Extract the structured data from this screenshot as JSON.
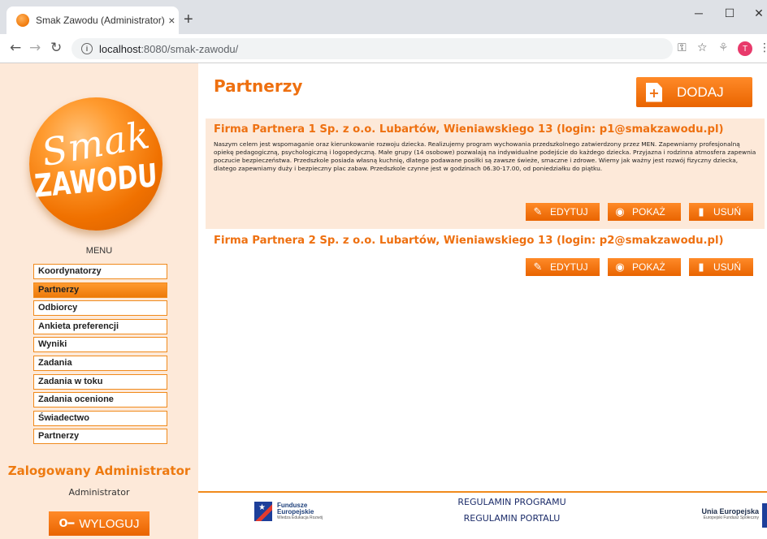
{
  "browser": {
    "tab_title": "Smak Zawodu (Administrator)",
    "tab_close": "×",
    "new_tab": "+",
    "url_host": "localhost",
    "url_path": ":8080/smak-zawodu/",
    "profile_initial": "T"
  },
  "sidebar": {
    "logo_top": "Smak",
    "logo_bottom": "ZAWODU",
    "menu_title": "MENU",
    "menu_items": [
      {
        "label": "Koordynatorzy",
        "active": false
      },
      {
        "label": "Partnerzy",
        "active": true
      },
      {
        "label": "Odbiorcy",
        "active": false
      },
      {
        "label": "Ankieta preferencji",
        "active": false
      },
      {
        "label": "Wyniki",
        "active": false
      },
      {
        "label": "Zadania",
        "active": false
      },
      {
        "label": "Zadania w toku",
        "active": false
      },
      {
        "label": "Zadania ocenione",
        "active": false
      },
      {
        "label": "Świadectwo",
        "active": false
      },
      {
        "label": "Partnerzy",
        "active": false
      }
    ],
    "logged_title": "Zalogowany Administrator",
    "logged_name": "Administrator",
    "logout_label": "WYLOGUJ"
  },
  "main": {
    "title": "Partnerzy",
    "add_label": "DODAJ",
    "edit_label": "EDYTUJ",
    "show_label": "POKAŻ",
    "delete_label": "USUŃ",
    "partners": [
      {
        "name": "Firma Partnera 1 Sp. z o.o. Lubartów, Wieniawskiego 13 (login: p1@smakzawodu.pl)",
        "description": "Naszym celem jest wspomaganie oraz kierunkowanie rozwoju dziecka. Realizujemy program wychowania przedszkolnego zatwierdzony przez MEN. Zapewniamy profesjonalną opiekę pedagogiczną, psychologiczną i logopedyczną. Małe grupy (14 osobowe) pozwalają na indywidualne podejście do każdego dziecka. Przyjazna i rodzinna atmosfera zapewnia poczucie bezpieczeństwa. Przedszkole posiada własną kuchnię, dlatego podawane posiłki są zawsze świeże, smaczne i zdrowe. Wiemy jak ważny jest rozwój fizyczny dziecka, dlatego zapewniamy duży i bezpieczny plac zabaw. Przedszkole czynne jest w godzinach 06.30-17.00, od poniedziałku do piątku."
      },
      {
        "name": "Firma Partnera 2 Sp. z o.o. Lubartów, Wieniawskiego 13 (login: p2@smakzawodu.pl)",
        "description": ""
      }
    ]
  },
  "footer": {
    "eu_funds_line1": "Fundusze",
    "eu_funds_line2": "Europejskie",
    "eu_funds_sub": "Wiedza Edukacja Rozwój",
    "link_program": "REGULAMIN PROGRAMU",
    "link_portal": "REGULAMIN PORTALU",
    "eu_union_title": "Unia Europejska",
    "eu_union_sub": "Europejski Fundusz Społeczny"
  },
  "colors": {
    "accent": "#ee7010",
    "sidebar_bg": "#fde9d9",
    "footer_link": "#1d2d6a"
  }
}
